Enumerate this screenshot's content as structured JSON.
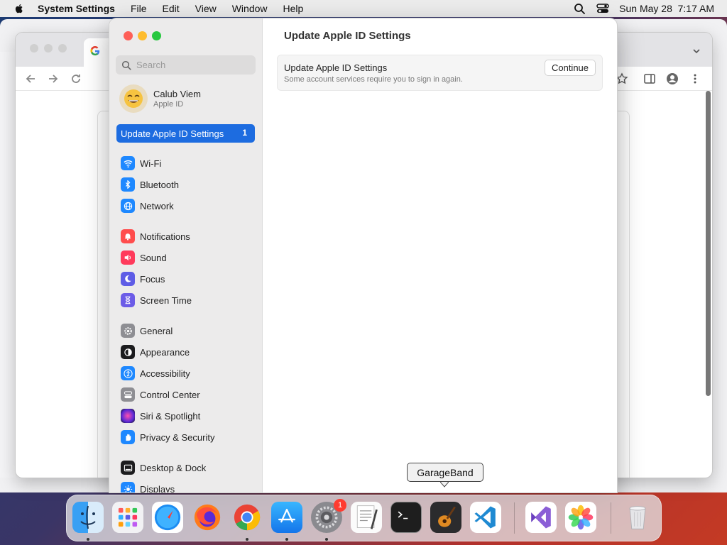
{
  "menubar": {
    "app_name": "System Settings",
    "items": [
      "File",
      "Edit",
      "View",
      "Window",
      "Help"
    ],
    "datetime": "Sun May 28  7:17 AM",
    "icons": [
      "apple-icon",
      "search-icon",
      "control-center-icon"
    ]
  },
  "settings": {
    "search_placeholder": "Search",
    "profile": {
      "name": "Calub Viem",
      "subtitle": "Apple ID"
    },
    "highlight": {
      "label": "Update Apple ID Settings",
      "badge": "1"
    },
    "sidebar_items": [
      {
        "label": "Wi-Fi",
        "icon": "wifi-icon",
        "color": "#1e88ff"
      },
      {
        "label": "Bluetooth",
        "icon": "bluetooth-icon",
        "color": "#1e88ff"
      },
      {
        "label": "Network",
        "icon": "globe-icon",
        "color": "#1e88ff"
      },
      {
        "label": "Notifications",
        "icon": "bell-icon",
        "color": "#ff4d4d"
      },
      {
        "label": "Sound",
        "icon": "speaker-icon",
        "color": "#ff3b5c"
      },
      {
        "label": "Focus",
        "icon": "moon-icon",
        "color": "#5e5ce6"
      },
      {
        "label": "Screen Time",
        "icon": "hourglass-icon",
        "color": "#6c5ce7"
      },
      {
        "label": "General",
        "icon": "gear-icon",
        "color": "#8e8e93"
      },
      {
        "label": "Appearance",
        "icon": "appearance-icon",
        "color": "#1c1c1e"
      },
      {
        "label": "Accessibility",
        "icon": "accessibility-icon",
        "color": "#1e88ff"
      },
      {
        "label": "Control Center",
        "icon": "control-center-icon",
        "color": "#8e8e93"
      },
      {
        "label": "Siri & Spotlight",
        "icon": "siri-icon",
        "color": "#b03a8c"
      },
      {
        "label": "Privacy & Security",
        "icon": "hand-icon",
        "color": "#1e88ff"
      },
      {
        "label": "Desktop & Dock",
        "icon": "dock-icon",
        "color": "#1c1c1e"
      },
      {
        "label": "Displays",
        "icon": "sun-icon",
        "color": "#1e88ff"
      }
    ],
    "content": {
      "title": "Update Apple ID Settings",
      "card_heading": "Update Apple ID Settings",
      "card_description": "Some account services require you to sign in again.",
      "button_label": "Continue"
    }
  },
  "dock": {
    "tooltip": "GarageBand",
    "apps": [
      {
        "name": "Finder",
        "icon": "finder-icon",
        "running": true
      },
      {
        "name": "Launchpad",
        "icon": "launchpad-icon",
        "running": false
      },
      {
        "name": "Safari",
        "icon": "safari-icon",
        "running": false
      },
      {
        "name": "Firefox",
        "icon": "firefox-icon",
        "running": false
      },
      {
        "name": "Chrome",
        "icon": "chrome-icon",
        "running": true
      },
      {
        "name": "App Store",
        "icon": "app-store-icon",
        "running": true
      },
      {
        "name": "System Settings",
        "icon": "system-settings-icon",
        "running": true,
        "badge": "1"
      },
      {
        "name": "TextEdit",
        "icon": "textedit-icon",
        "running": false
      },
      {
        "name": "Terminal",
        "icon": "terminal-icon",
        "running": false
      },
      {
        "name": "GarageBand",
        "icon": "garageband-icon",
        "running": false
      },
      {
        "name": "Visual Studio Code",
        "icon": "vscode-icon",
        "running": false
      },
      {
        "name": "Visual Studio",
        "icon": "visual-studio-icon",
        "running": false
      },
      {
        "name": "Photos",
        "icon": "photos-icon",
        "running": false
      },
      {
        "name": "Trash",
        "icon": "trash-icon",
        "running": false
      }
    ]
  },
  "colors": {
    "accent": "#1d6ce0",
    "close": "#fe5f57",
    "minimize": "#febc2e",
    "maximize": "#28c840"
  }
}
